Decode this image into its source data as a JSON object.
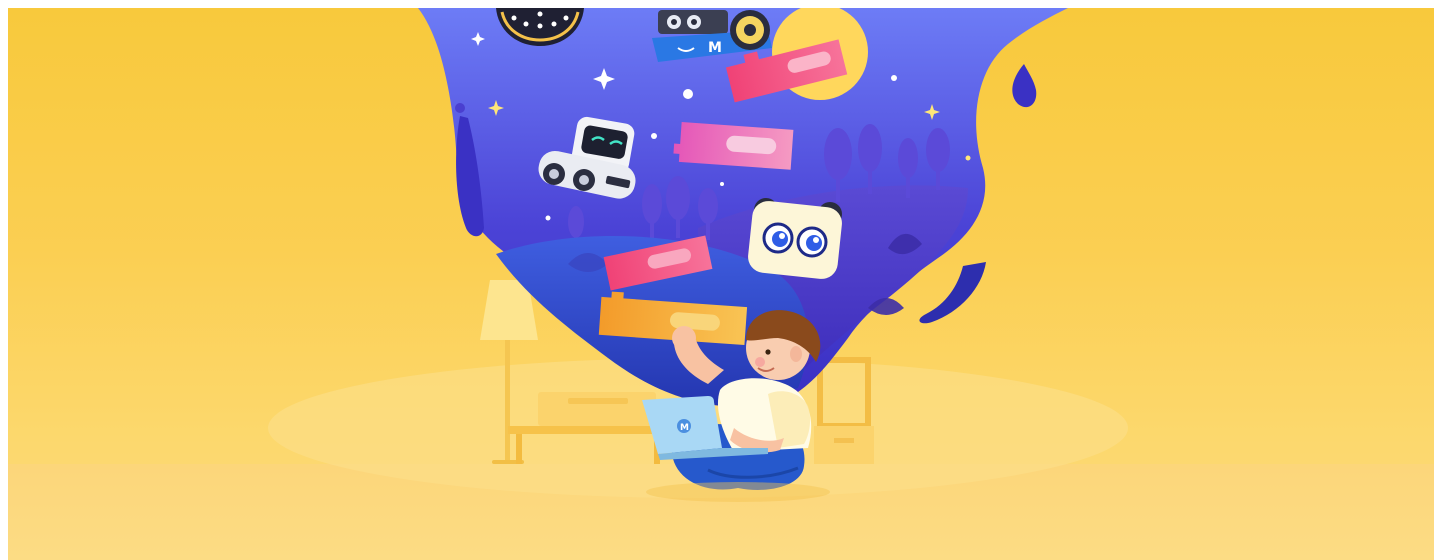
{
  "banner": {
    "palette": {
      "background": "#fbcf53",
      "floor": "#fcd877",
      "portal": "#3f34c9",
      "portal_light": "#6b6df0",
      "hill": "#2a3bb5",
      "tree": "#5a49d6",
      "block_pink": "#f24f80",
      "block_magenta": "#e85ca8",
      "block_orange": "#f5a83a",
      "laptop": "#a9d8f5",
      "shirt": "#fffbe8",
      "pants": "#2257c9",
      "hair": "#8a4a1c"
    },
    "icons": {
      "laptop_logo": "m-logo-icon",
      "robot_panel_letter": "m-logo-icon"
    },
    "robot_label": "M"
  }
}
